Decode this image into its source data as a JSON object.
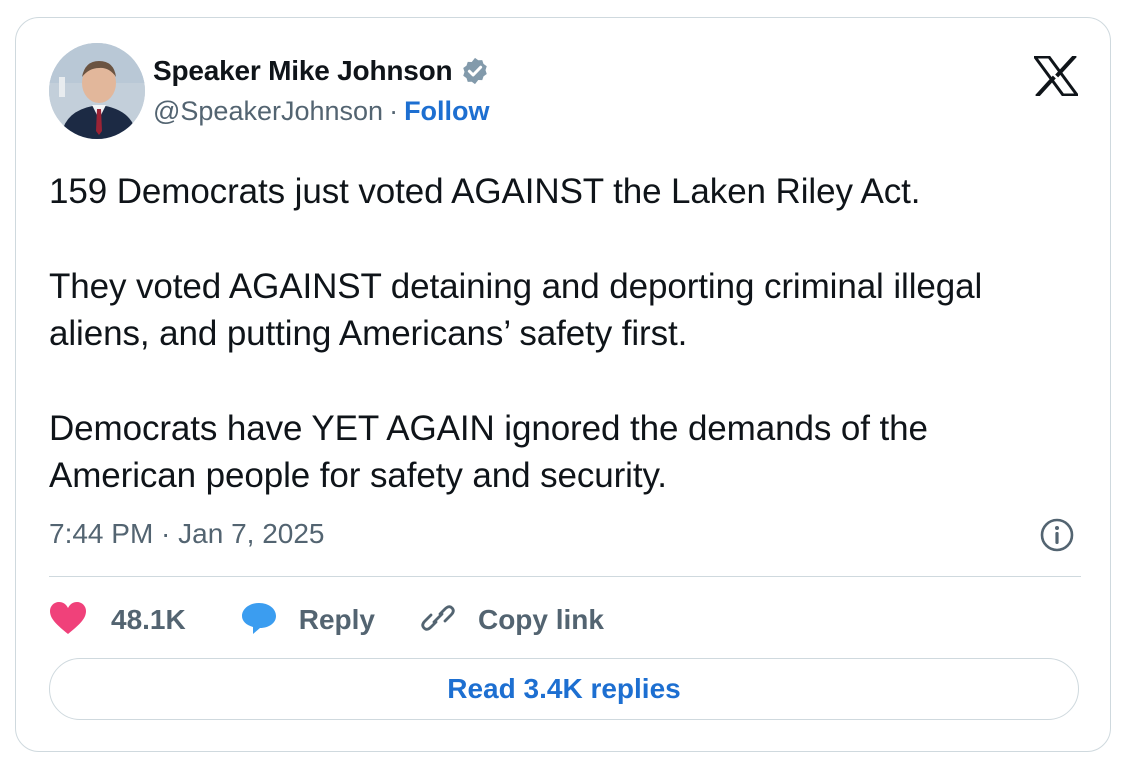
{
  "author": {
    "name": "Speaker Mike Johnson",
    "handle": "@SpeakerJohnson",
    "separator": "·",
    "follow_label": "Follow",
    "verified_icon": "verified-badge-icon"
  },
  "tweet": {
    "paragraphs": [
      "159 Democrats just voted AGAINST the Laken Riley Act.",
      "They voted AGAINST detaining and deporting criminal illegal aliens, and putting Americans’ safety first.",
      "Democrats have YET AGAIN ignored the demands of the American people for safety and security."
    ],
    "timestamp": "7:44 PM · Jan 7, 2025"
  },
  "actions": {
    "likes": "48.1K",
    "reply_label": "Reply",
    "copy_label": "Copy link"
  },
  "footer": {
    "read_replies_label": "Read 3.4K replies"
  },
  "colors": {
    "link": "#1d6fd1",
    "like": "#f0417a",
    "reply": "#3b9df0",
    "muted": "#536471",
    "border": "#cfd9de",
    "verified": "#829aab"
  },
  "icons": [
    "x-logo-icon",
    "info-icon",
    "heart-icon",
    "reply-bubble-icon",
    "link-icon"
  ]
}
